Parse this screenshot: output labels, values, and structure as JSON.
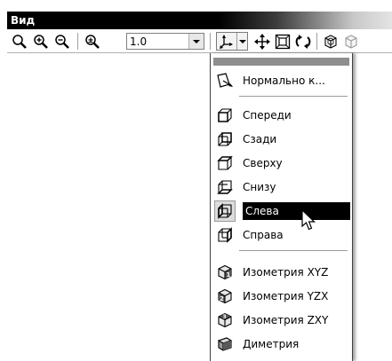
{
  "window": {
    "title": "Вид"
  },
  "toolbar": {
    "zoom_value": "1.0",
    "buttons": [
      {
        "icon": "magnifier-icon"
      },
      {
        "icon": "zoom-in-icon"
      },
      {
        "icon": "zoom-out-icon"
      },
      {
        "icon": "zoom-scale-icon"
      },
      {
        "icon": "orientation-icon"
      },
      {
        "icon": "pan-icon"
      },
      {
        "icon": "zoom-all-icon"
      },
      {
        "icon": "rotate-icon"
      },
      {
        "icon": "render-mode-icon"
      }
    ]
  },
  "menu": {
    "items": [
      {
        "label": "Нормально к...",
        "icon": "normal-to-icon"
      },
      {
        "label": "Спереди",
        "icon": "view-front-icon"
      },
      {
        "label": "Сзади",
        "icon": "view-back-icon"
      },
      {
        "label": "Сверху",
        "icon": "view-top-icon"
      },
      {
        "label": "Снизу",
        "icon": "view-bottom-icon"
      },
      {
        "label": "Слева",
        "icon": "view-left-icon",
        "selected": true
      },
      {
        "label": "Справа",
        "icon": "view-right-icon"
      },
      {
        "label": "Изометрия XYZ",
        "icon": "isometric-xyz-icon"
      },
      {
        "label": "Изометрия YZX",
        "icon": "isometric-yzx-icon"
      },
      {
        "label": "Изометрия ZXY",
        "icon": "isometric-zxy-icon"
      },
      {
        "label": "Диметрия",
        "icon": "dimetric-icon"
      }
    ]
  },
  "colors": {
    "selection": "#000000",
    "menu_bg": "#ffffff",
    "grip": "#8e8e8e"
  }
}
